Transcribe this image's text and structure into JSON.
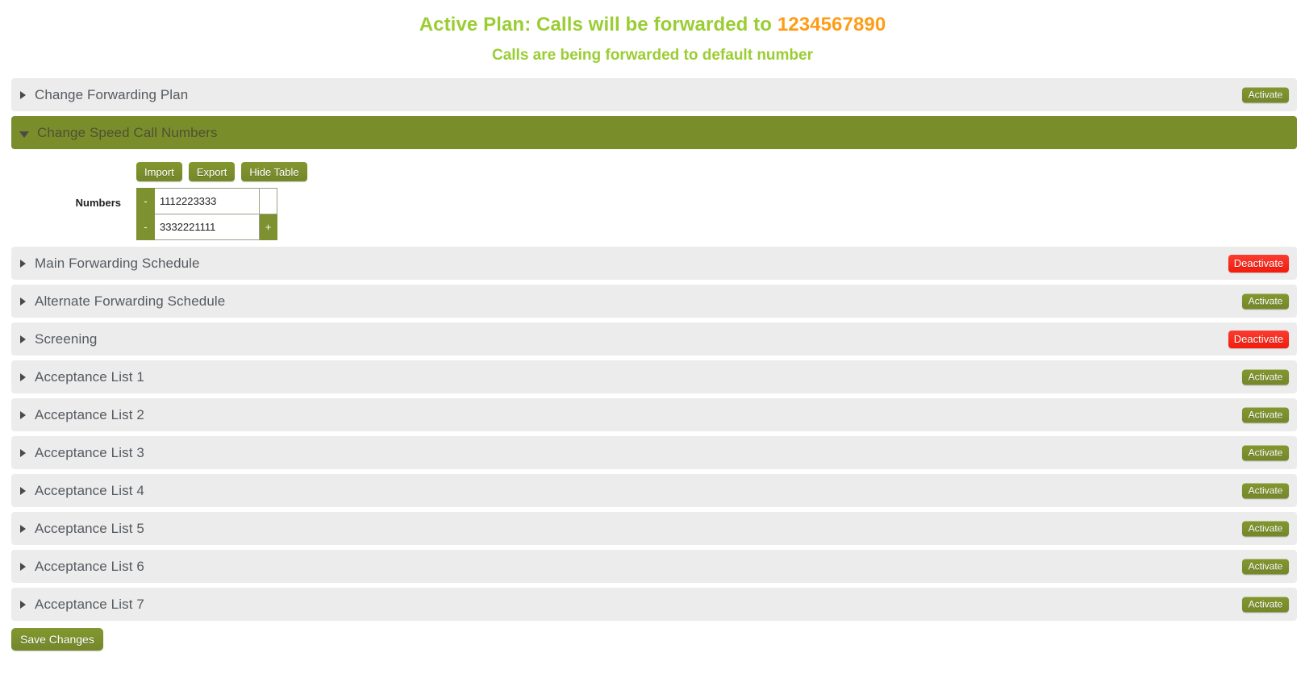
{
  "banner": {
    "line1_prefix": "Active Plan: Calls will be forwarded to ",
    "forward_number": "1234567890",
    "line2": "Calls are being forwarded to default number",
    "green_color": "#9ACD32",
    "orange_color": "#FF9C16"
  },
  "accordion": {
    "items": [
      {
        "label": "Change Forwarding Plan",
        "expanded": false,
        "action": "Activate",
        "action_type": "activate"
      },
      {
        "label": "Change Speed Call Numbers",
        "expanded": true,
        "action": "",
        "action_type": "none"
      },
      {
        "label": "Main Forwarding Schedule",
        "expanded": false,
        "action": "Deactivate",
        "action_type": "deactivate"
      },
      {
        "label": "Alternate Forwarding Schedule",
        "expanded": false,
        "action": "Activate",
        "action_type": "activate"
      },
      {
        "label": "Screening",
        "expanded": false,
        "action": "Deactivate",
        "action_type": "deactivate"
      },
      {
        "label": "Acceptance List 1",
        "expanded": false,
        "action": "Activate",
        "action_type": "activate"
      },
      {
        "label": "Acceptance List 2",
        "expanded": false,
        "action": "Activate",
        "action_type": "activate"
      },
      {
        "label": "Acceptance List 3",
        "expanded": false,
        "action": "Activate",
        "action_type": "activate"
      },
      {
        "label": "Acceptance List 4",
        "expanded": false,
        "action": "Activate",
        "action_type": "activate"
      },
      {
        "label": "Acceptance List 5",
        "expanded": false,
        "action": "Activate",
        "action_type": "activate"
      },
      {
        "label": "Acceptance List 6",
        "expanded": false,
        "action": "Activate",
        "action_type": "activate"
      },
      {
        "label": "Acceptance List 7",
        "expanded": false,
        "action": "Activate",
        "action_type": "activate"
      }
    ]
  },
  "speed_call_panel": {
    "import_label": "Import",
    "export_label": "Export",
    "hide_table_label": "Hide Table",
    "numbers_label": "Numbers",
    "remove_icon": "-",
    "add_icon": "+",
    "rows": [
      {
        "value": "1112223333",
        "has_add": false
      },
      {
        "value": "3332221111",
        "has_add": true
      }
    ]
  },
  "footer": {
    "save_label": "Save Changes"
  }
}
